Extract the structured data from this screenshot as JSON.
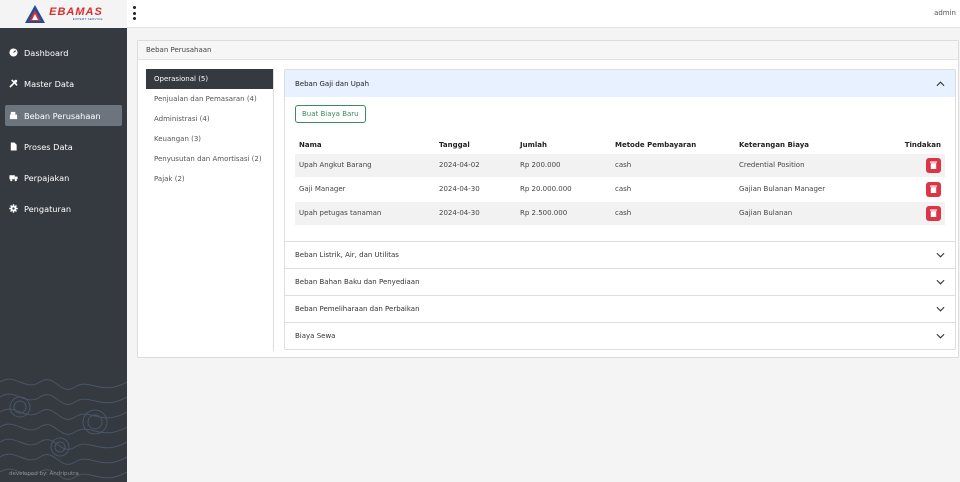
{
  "brand": {
    "logo_text": "EBAMAS",
    "logo_sub": "EXPERT SERVICE"
  },
  "header": {
    "user": "admin"
  },
  "sidebar": {
    "items": [
      {
        "label": "Dashboard",
        "icon": "dashboard-icon"
      },
      {
        "label": "Master Data",
        "icon": "tools-icon"
      },
      {
        "label": "Beban Perusahaan",
        "icon": "cash-register-icon",
        "active": true
      },
      {
        "label": "Proses Data",
        "icon": "file-icon"
      },
      {
        "label": "Perpajakan",
        "icon": "truck-icon"
      },
      {
        "label": "Pengaturan",
        "icon": "gear-icon"
      }
    ],
    "footer": "developed by: Andriputra"
  },
  "page": {
    "title": "Beban Perusahaan"
  },
  "categories": [
    {
      "label": "Operasional (5)",
      "active": true
    },
    {
      "label": "Penjualan dan Pemasaran (4)"
    },
    {
      "label": "Administrasi (4)"
    },
    {
      "label": "Keuangan (3)"
    },
    {
      "label": "Penyusutan dan Amortisasi (2)"
    },
    {
      "label": "Pajak (2)"
    }
  ],
  "accordion": {
    "open": {
      "title": "Beban Gaji dan Upah",
      "new_button": "Buat Biaya Baru",
      "columns": [
        "Nama",
        "Tanggal",
        "Jumlah",
        "Metode Pembayaran",
        "Keterangan Biaya",
        "Tindakan"
      ],
      "rows": [
        [
          "Upah Angkut Barang",
          "2024-04-02",
          "Rp 200.000",
          "cash",
          "Credential Position"
        ],
        [
          "Gaji Manager",
          "2024-04-30",
          "Rp 20.000.000",
          "cash",
          "Gajian Bulanan Manager"
        ],
        [
          "Upah petugas tanaman",
          "2024-04-30",
          "Rp 2.500.000",
          "cash",
          "Gajian Bulanan"
        ]
      ]
    },
    "collapsed": [
      "Beban Listrik, Air, dan Utilitas",
      "Beban Bahan Baku dan Penyediaan",
      "Beban Pemeliharaan dan Perbaikan",
      "Biaya Sewa"
    ]
  },
  "colors": {
    "sidebar": "#353a40",
    "active_nav": "#6c757d",
    "accordion_open": "#e7f1ff",
    "delete": "#dc3545",
    "new_button": "#3a8a5c"
  }
}
